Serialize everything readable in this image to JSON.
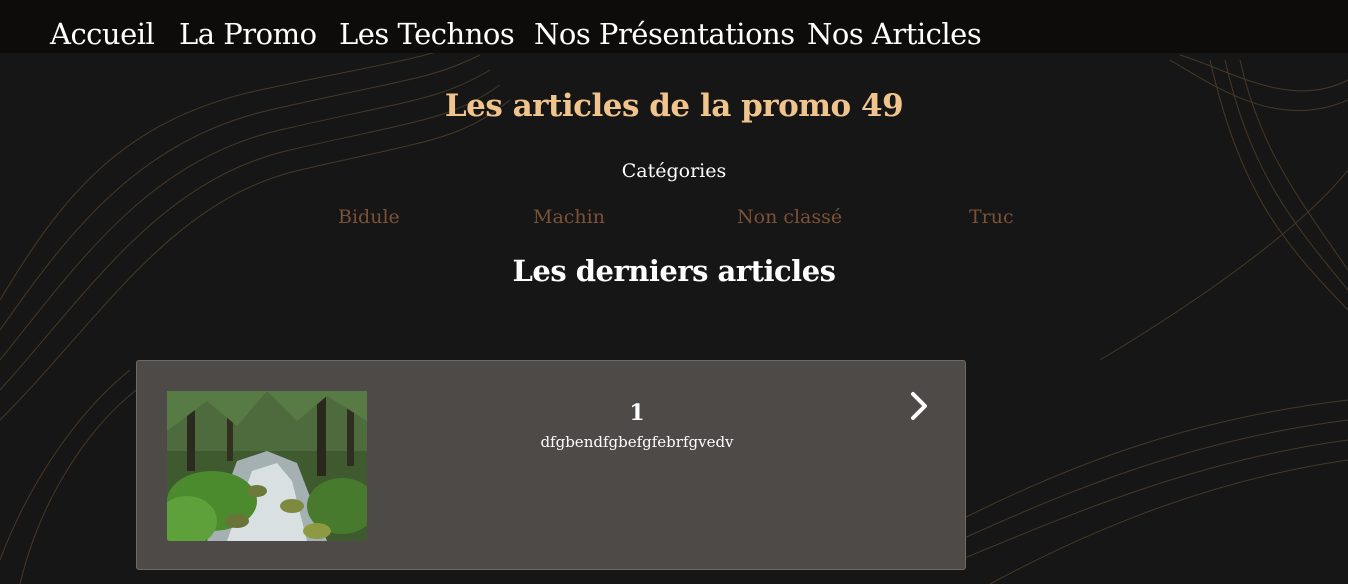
{
  "nav": {
    "items": [
      {
        "label": "Accueil"
      },
      {
        "label": "La Promo"
      },
      {
        "label": "Les Technos"
      },
      {
        "label": "Nos Présentations"
      },
      {
        "label": "Nos Articles"
      }
    ]
  },
  "main": {
    "title": "Les articles de la promo 49",
    "categories_heading": "Catégories",
    "categories": [
      "Bidule",
      "Machin",
      "Non classé",
      "Truc"
    ],
    "latest_heading": "Les derniers articles",
    "articles": [
      {
        "number": "1",
        "excerpt": "dfgbendfgbefgfebrfgvedv",
        "thumbnail": "forest-stream-image",
        "action_icon": "chevron-right-icon"
      }
    ]
  },
  "colors": {
    "background": "#161616",
    "navbar": "#0d0c0b",
    "title_accent": "#f0c48c",
    "category_link": "#7a5236",
    "card": "#4e4a47",
    "decorative_lines": "#8a6a44"
  }
}
